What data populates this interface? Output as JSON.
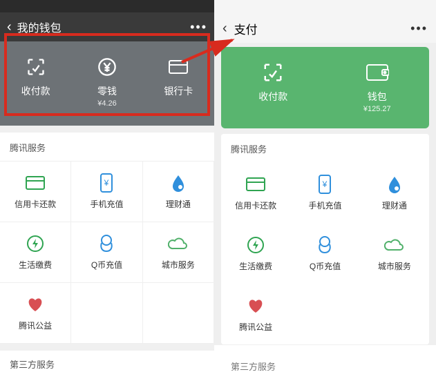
{
  "left": {
    "nav_title": "我的钱包",
    "hero": [
      {
        "label": "收付款"
      },
      {
        "label": "零钱",
        "sub": "¥4.26"
      },
      {
        "label": "银行卡"
      }
    ],
    "section_title": "腾讯服务",
    "services": [
      {
        "label": "信用卡还款"
      },
      {
        "label": "手机充值"
      },
      {
        "label": "理财通"
      },
      {
        "label": "生活缴费"
      },
      {
        "label": "Q币充值"
      },
      {
        "label": "城市服务"
      },
      {
        "label": "腾讯公益"
      }
    ],
    "section2_truncated": "第三方服务"
  },
  "right": {
    "nav_title": "支付",
    "hero": [
      {
        "label": "收付款"
      },
      {
        "label": "钱包",
        "sub": "¥125.27"
      }
    ],
    "section_title": "腾讯服务",
    "services": [
      {
        "label": "信用卡还款"
      },
      {
        "label": "手机充值"
      },
      {
        "label": "理财通"
      },
      {
        "label": "生活缴费"
      },
      {
        "label": "Q币充值"
      },
      {
        "label": "城市服务"
      },
      {
        "label": "腾讯公益"
      }
    ],
    "section2_title": "第三方服务"
  },
  "colors": {
    "green": "#2fa451",
    "blue": "#2f8fdc",
    "red": "#d84f53",
    "outline": "#d82b1e",
    "card_green": "#59b56f"
  }
}
